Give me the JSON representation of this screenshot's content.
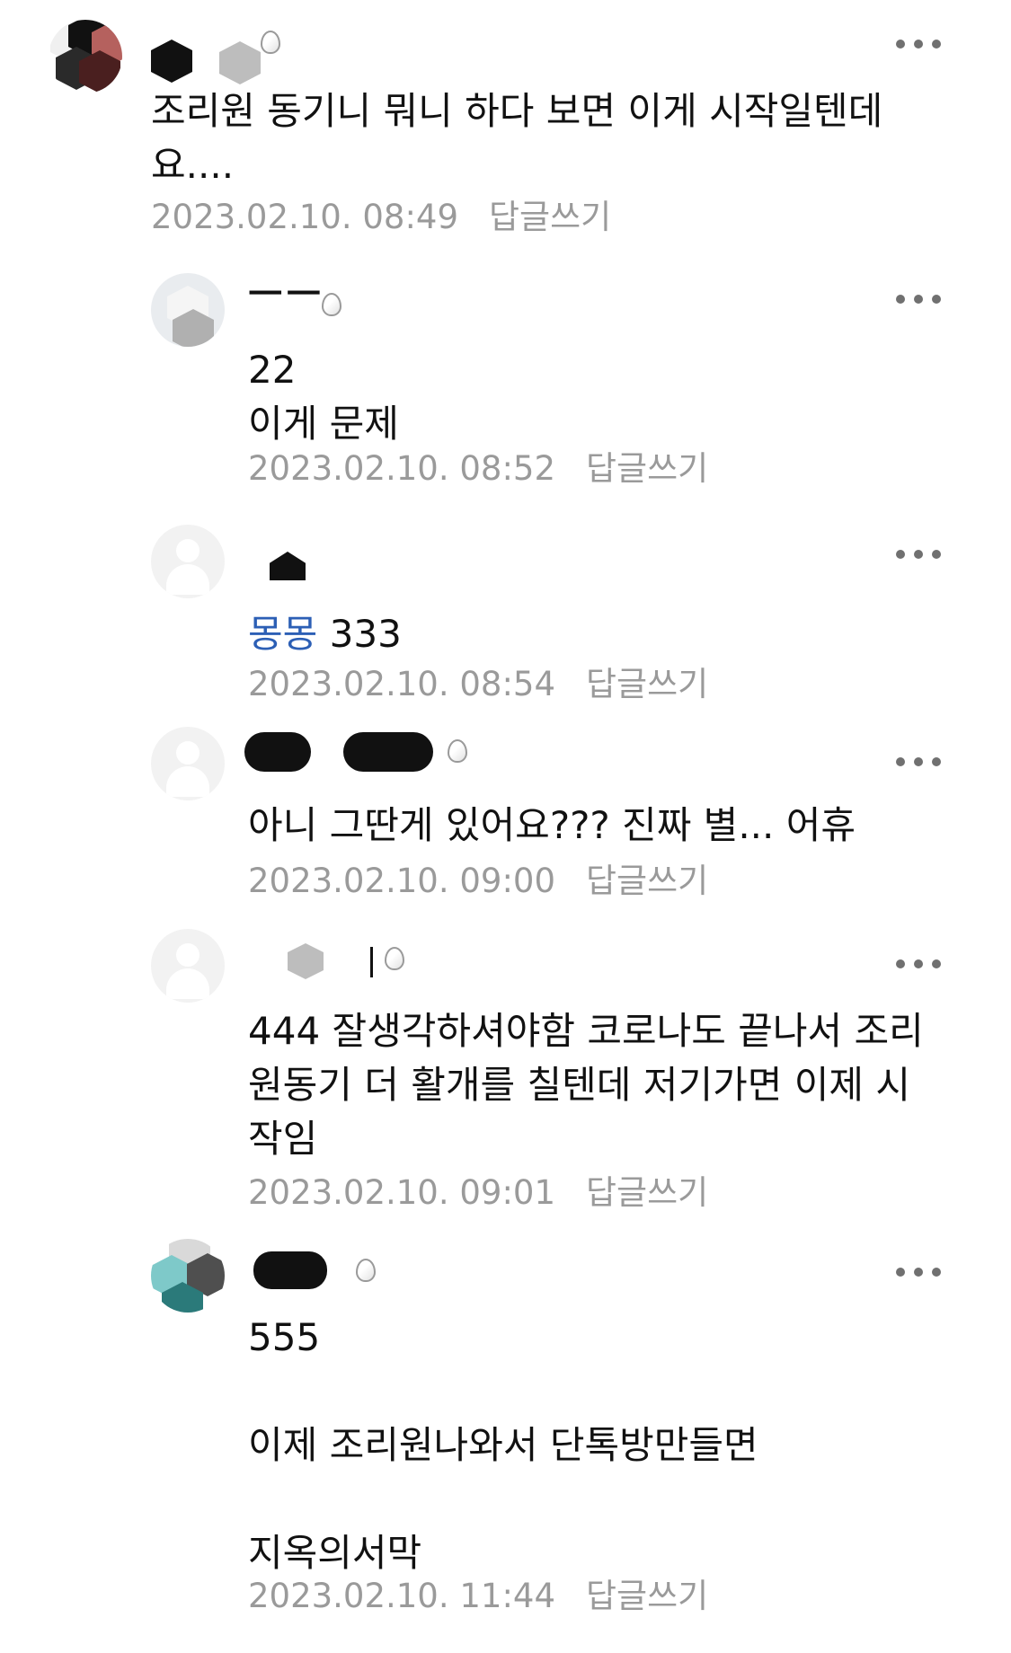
{
  "comments": [
    {
      "text": "조리원 동기니 뭐니 하다 보면 이게 시작일텐데\n요....",
      "time": "2023.02.10. 08:49",
      "reply_label": "답글쓰기"
    },
    {
      "nickname": "ㅡㅡ",
      "text": "22\n이게 문제",
      "time": "2023.02.10. 08:52",
      "reply_label": "답글쓰기"
    },
    {
      "mention": "몽몽",
      "text": " 333",
      "time": "2023.02.10. 08:54",
      "reply_label": "답글쓰기"
    },
    {
      "text": "아니 그딴게 있어요??? 진짜 별... 어휴",
      "time": "2023.02.10. 09:00",
      "reply_label": "답글쓰기"
    },
    {
      "text": "444 잘생각하셔야함 코로나도 끝나서 조리\n원동기 더 활개를 칠텐데 저기가면 이제 시\n작임",
      "time": "2023.02.10. 09:01",
      "reply_label": "답글쓰기"
    },
    {
      "text": "555\n\n이제 조리원나와서 단톡방만들면\n\n지옥의서막",
      "time": "2023.02.10. 11:44",
      "reply_label": "답글쓰기"
    }
  ],
  "icons": {
    "more": "more-horizontal-icon",
    "level": "egg-icon",
    "avatar_default": "default-profile-icon"
  },
  "colors": {
    "text": "#111111",
    "meta": "#9a9a9a",
    "mention": "#2c5fb5",
    "more_dots": "#707070"
  }
}
